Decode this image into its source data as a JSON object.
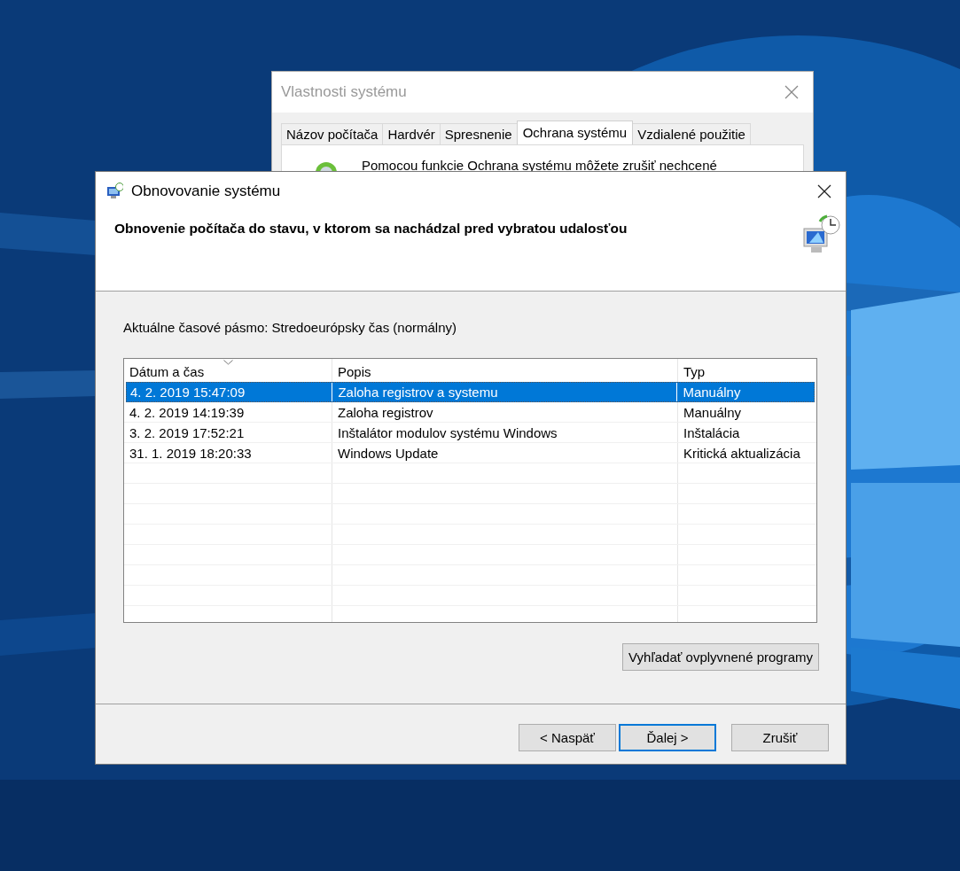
{
  "back_window": {
    "title": "Vlastnosti systému",
    "tabs": [
      {
        "label": "Názov počítača",
        "selected": false
      },
      {
        "label": "Hardvér",
        "selected": false
      },
      {
        "label": "Spresnenie",
        "selected": false
      },
      {
        "label": "Ochrana systému",
        "selected": true
      },
      {
        "label": "Vzdialené použitie",
        "selected": false
      }
    ],
    "description": "Pomocou funkcie Ochrana systému môžete zrušiť nechcené"
  },
  "dialog": {
    "title": "Obnovovanie systému",
    "heading": "Obnovenie počítača do stavu, v ktorom sa nachádzal pred vybratou udalosťou",
    "timezone_label": "Aktuálne časové pásmo: Stredoeurópsky čas (normálny)",
    "table": {
      "columns": [
        {
          "label": "Dátum a čas",
          "sorted": true
        },
        {
          "label": "Popis",
          "sorted": false
        },
        {
          "label": "Typ",
          "sorted": false
        }
      ],
      "rows": [
        {
          "cells": [
            "4. 2. 2019 15:47:09",
            "Zaloha registrov a systemu",
            "Manuálny"
          ],
          "selected": true
        },
        {
          "cells": [
            "4. 2. 2019 14:19:39",
            "Zaloha registrov",
            "Manuálny"
          ],
          "selected": false
        },
        {
          "cells": [
            "3. 2. 2019 17:52:21",
            "Inštalátor modulov systému Windows",
            "Inštalácia"
          ],
          "selected": false
        },
        {
          "cells": [
            "31. 1. 2019 18:20:33",
            "Windows Update",
            "Kritická aktualizácia"
          ],
          "selected": false
        }
      ]
    },
    "scan_button": "Vyhľadať ovplyvnené programy",
    "buttons": [
      {
        "label": "< Naspäť",
        "default": false
      },
      {
        "label": "Ďalej >",
        "default": true
      },
      {
        "label": "Zrušiť",
        "default": false
      }
    ]
  }
}
